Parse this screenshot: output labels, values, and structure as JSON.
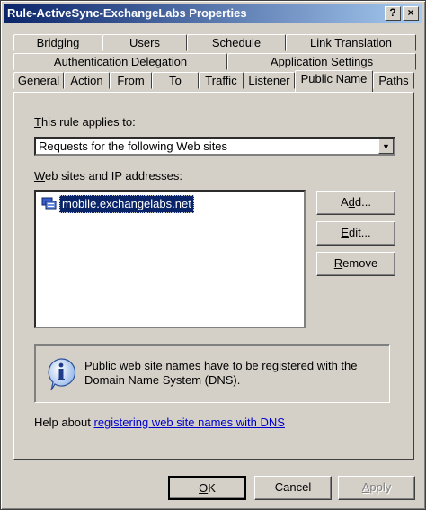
{
  "window": {
    "title": "Rule-ActiveSync-ExchangeLabs Properties",
    "help_button": "?",
    "close_button": "×"
  },
  "tabs": {
    "row1": [
      "Bridging",
      "Users",
      "Schedule",
      "Link Translation"
    ],
    "row2": [
      "Authentication Delegation",
      "Application Settings"
    ],
    "row3": [
      "General",
      "Action",
      "From",
      "To",
      "Traffic",
      "Listener",
      "Public Name",
      "Paths"
    ],
    "active": "Public Name"
  },
  "public_name": {
    "applies_label_u": "T",
    "applies_label_rest": "his rule applies to:",
    "applies_value": "Requests for the following Web sites",
    "sites_label_u": "W",
    "sites_label_rest": "eb sites and IP addresses:",
    "sites": [
      "mobile.exchangelabs.net"
    ],
    "add_button_pre": "A",
    "add_button_u": "d",
    "add_button_post": "d...",
    "edit_button_u": "E",
    "edit_button_post": "dit...",
    "remove_button_u": "R",
    "remove_button_post": "emove",
    "info_text": "Public web site names have to be registered with the Domain Name System (DNS).",
    "help_prefix": "Help about ",
    "help_link": "registering web site names with DNS"
  },
  "footer": {
    "ok_label_u": "O",
    "ok_label_post": "K",
    "cancel_label": "Cancel",
    "apply_label_u": "A",
    "apply_label_post": "pply"
  },
  "colors": {
    "face": "#d4d0c8",
    "title_start": "#0a246a",
    "title_end": "#a6caf0",
    "selection": "#0a246a",
    "link": "#0000cc"
  }
}
